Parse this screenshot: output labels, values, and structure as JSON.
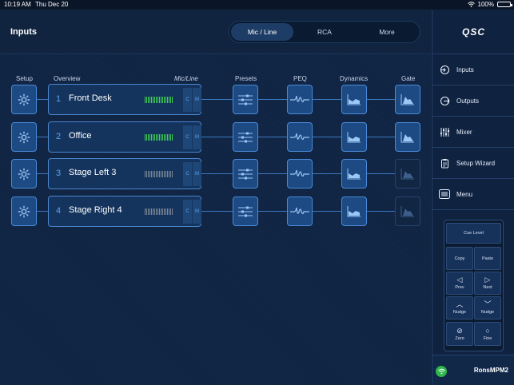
{
  "status_bar": {
    "time": "10:19 AM",
    "date": "Thu Dec 20",
    "battery": "100%",
    "battery_level": 1.0
  },
  "header": {
    "title": "Inputs",
    "tabs": [
      "Mic / Line",
      "RCA",
      "More"
    ],
    "active_tab": "Mic / Line"
  },
  "columns": {
    "setup": "Setup",
    "overview": "Overview",
    "mic_line": "Mic/Line",
    "presets": "Presets",
    "peq": "PEQ",
    "dynamics": "Dynamics",
    "gate": "Gate"
  },
  "channels": [
    {
      "number": "1",
      "name": "Front Desk",
      "meter": "green",
      "c": "C",
      "m": "M",
      "gate_active": true
    },
    {
      "number": "2",
      "name": "Office",
      "meter": "green",
      "c": "C",
      "m": "M",
      "gate_active": true
    },
    {
      "number": "3",
      "name": "Stage Left 3",
      "meter": "gray",
      "c": "C",
      "m": "M",
      "gate_active": false
    },
    {
      "number": "4",
      "name": "Stage Right 4",
      "meter": "gray",
      "c": "C",
      "m": "M",
      "gate_active": false
    }
  ],
  "sidebar": {
    "logo": "QSC",
    "items": [
      {
        "label": "Inputs",
        "icon": "input-arrow-icon"
      },
      {
        "label": "Outputs",
        "icon": "output-arrow-icon"
      },
      {
        "label": "Mixer",
        "icon": "mixer-faders-icon"
      },
      {
        "label": "Setup Wizard",
        "icon": "clipboard-icon"
      },
      {
        "label": "Menu",
        "icon": "menu-list-icon"
      }
    ],
    "pad": {
      "cue_level": "Cue Level",
      "copy": "Copy",
      "paste": "Paste",
      "prev": "Prev",
      "next": "Next",
      "nudge_up": "Nudge",
      "nudge_down": "Nudge",
      "zero": "Zero",
      "fine": "Fine"
    },
    "device_name": "RonsMPM2"
  },
  "colors": {
    "accent": "#4a8ad8",
    "meter_active": "#3ccd52",
    "background": "#0d1d33"
  }
}
